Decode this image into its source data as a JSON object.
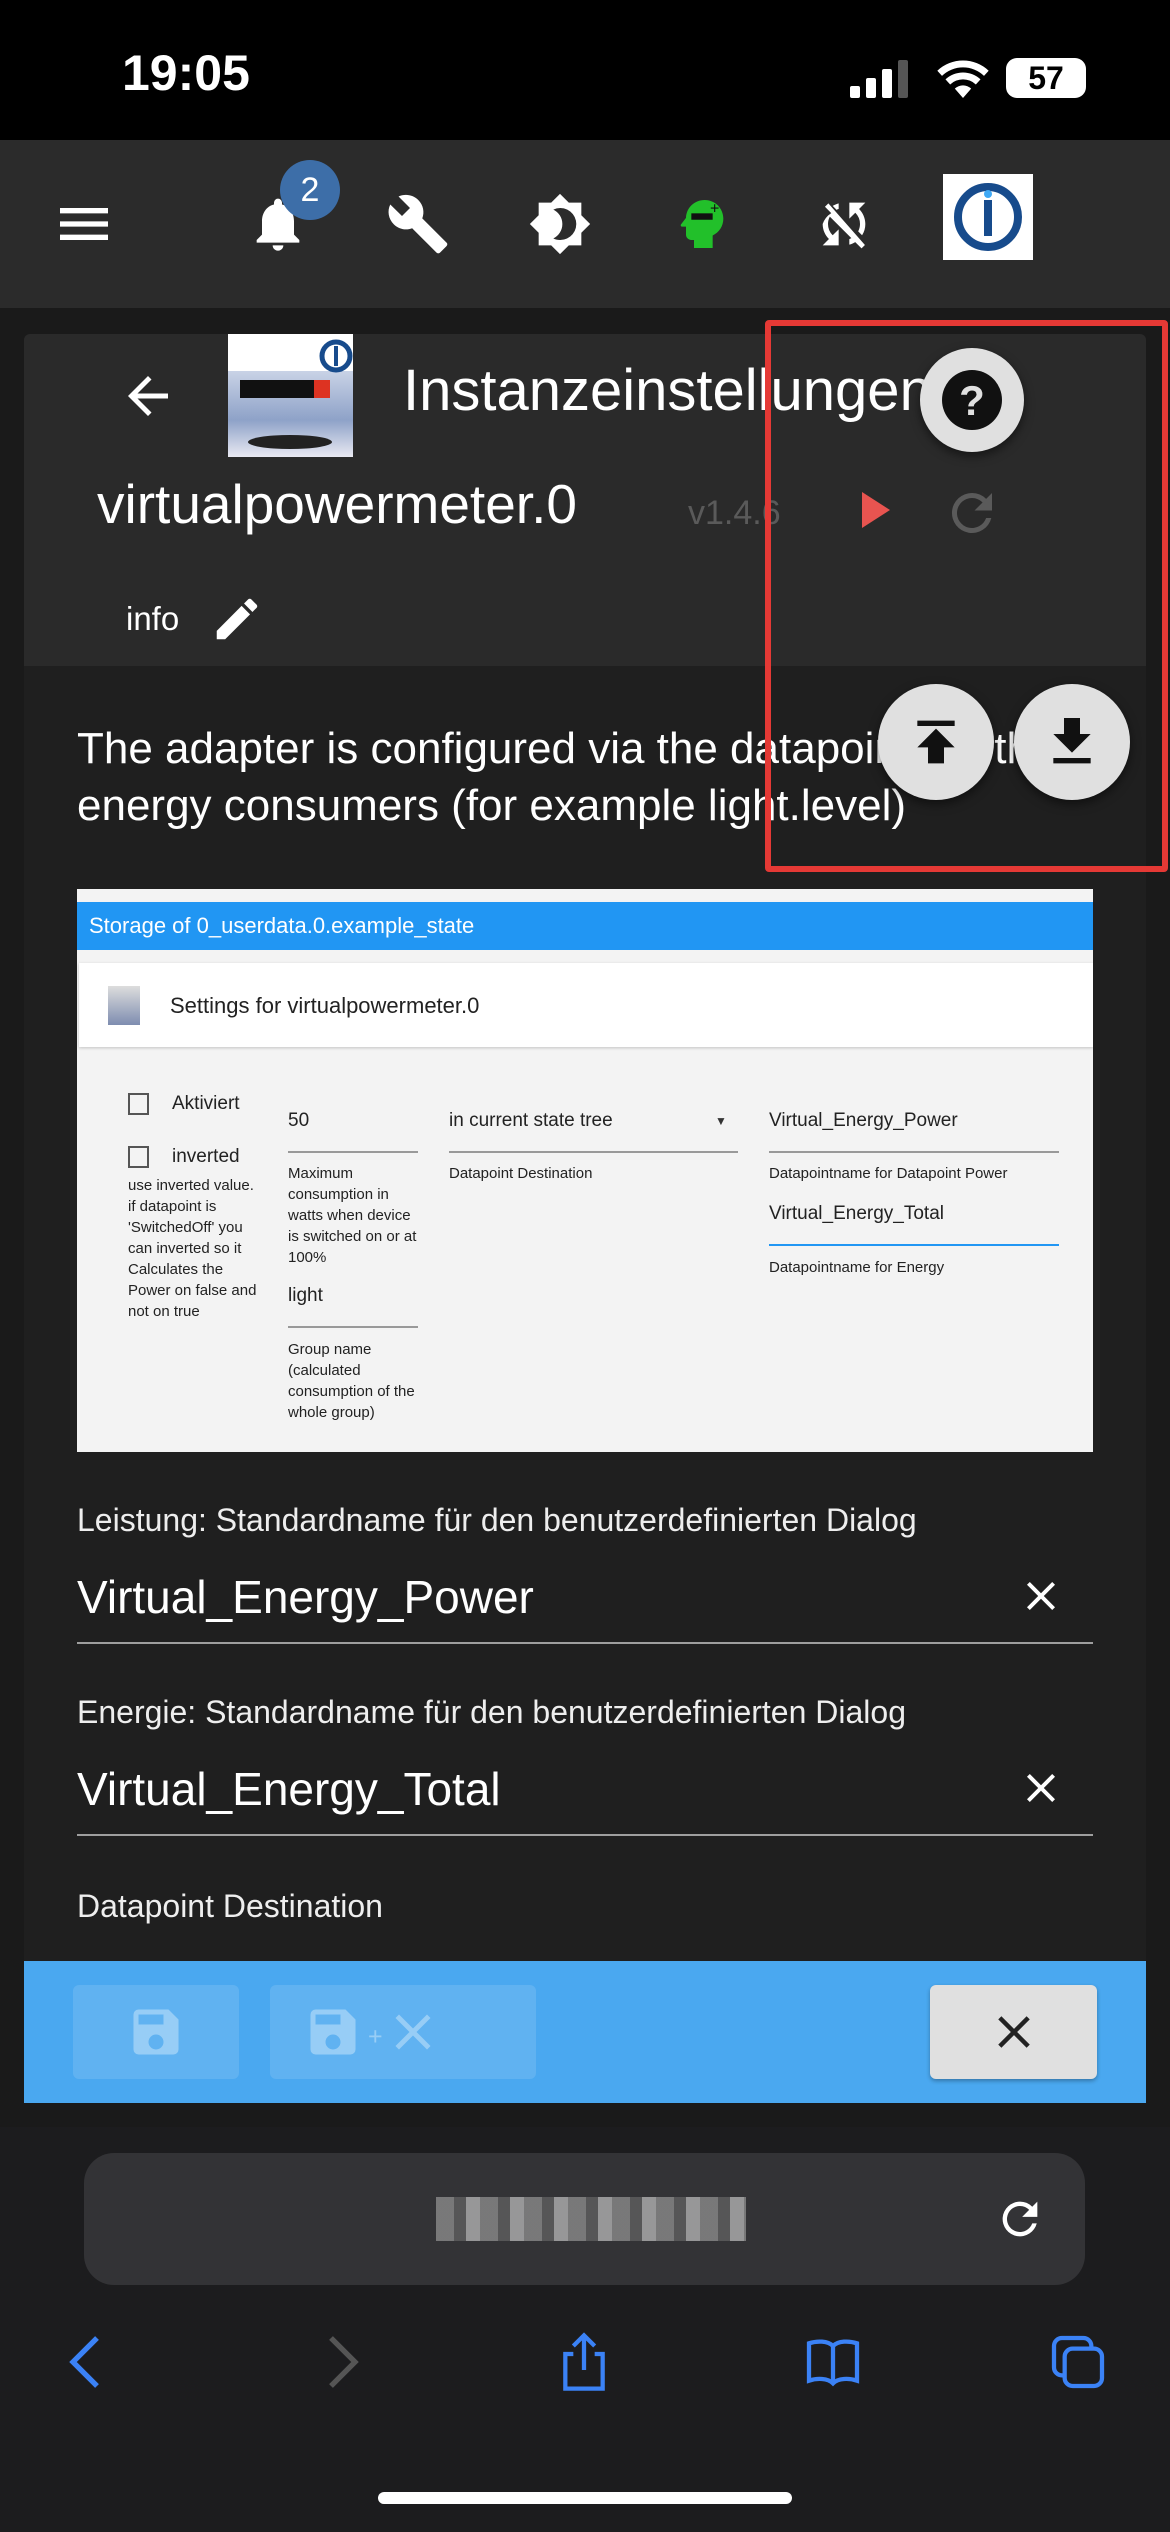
{
  "status_bar": {
    "time": "19:05",
    "battery": "57"
  },
  "toolbar": {
    "notification_count": "2",
    "icons": [
      "menu-icon",
      "bell-icon",
      "wrench-icon",
      "brightness-icon",
      "expert-head-icon",
      "sync-disabled-icon",
      "iobroker-logo"
    ]
  },
  "dialog": {
    "title": "Instanzeinstellungen",
    "instance": "virtualpowermeter.0",
    "version": "v1.4.6",
    "info_label": "info",
    "description": "The adapter is configured via the datapoints of the energy consumers (for example light.level)",
    "screenshot": {
      "storage_title": "Storage of 0_userdata.0.example_state",
      "settings_title": "Settings for virtualpowermeter.0",
      "aktiviert": "Aktiviert",
      "inverted": "inverted",
      "inverted_help": "use inverted value. if datapoint is 'SwitchedOff' you can inverted so it Calculates the Power on false and not on true",
      "max_value": "50",
      "max_label": "Maximum consumption in watts when device is switched on or at 100%",
      "group_value": "light",
      "group_label": "Group name (calculated consumption of the whole group)",
      "dest_value": "in current state tree",
      "dest_label": "Datapoint Destination",
      "power_value": "Virtual_Energy_Power",
      "power_label": "Datapointname for Datapoint Power",
      "energy_value": "Virtual_Energy_Total",
      "energy_label": "Datapointname for Energy"
    },
    "fields": [
      {
        "label": "Leistung: Standardname für den benutzerdefinierten Dialog",
        "value": "Virtual_Energy_Power"
      },
      {
        "label": "Energie: Standardname für den benutzerdefinierten Dialog",
        "value": "Virtual_Energy_Total"
      }
    ],
    "section_label": "Datapoint Destination"
  },
  "colors": {
    "accent": "#4aa8f0",
    "highlight_box": "#e53935",
    "play": "#e85450",
    "badge": "#3d6ea8"
  }
}
